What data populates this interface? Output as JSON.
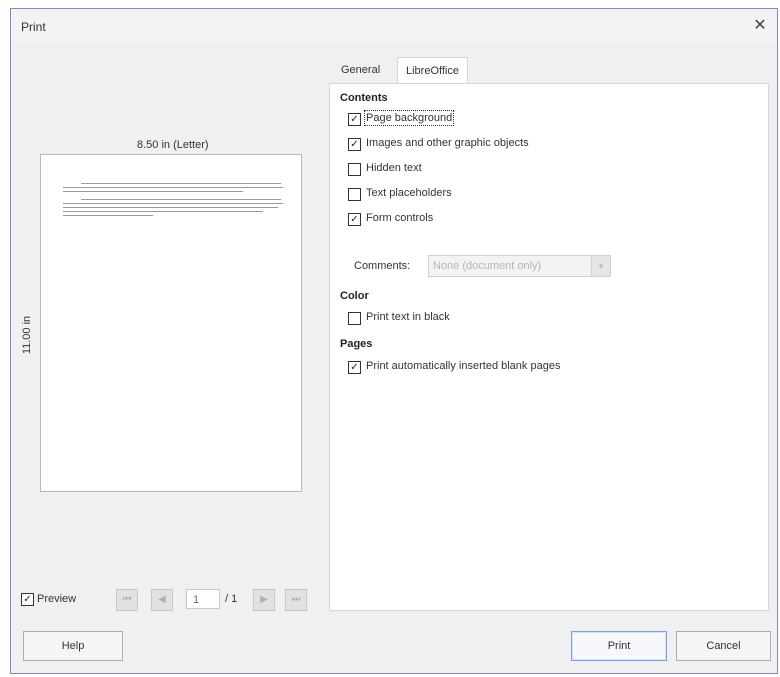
{
  "window": {
    "title": "Print",
    "close_glyph": "✕"
  },
  "preview": {
    "width_label": "8.50 in (Letter)",
    "height_label": "11.00 in",
    "preview_checkbox_label": "Preview",
    "preview_checked": true,
    "page_input_value": "1",
    "page_total": "/ 1"
  },
  "tabs": [
    "General",
    "LibreOffice Writer"
  ],
  "active_tab": "LibreOffice Writer",
  "writer": {
    "contents_heading": "Contents",
    "options": [
      {
        "label": "Page background",
        "checked": true
      },
      {
        "label": "Images and other graphic objects",
        "checked": true
      },
      {
        "label": "Hidden text",
        "checked": false
      },
      {
        "label": "Text placeholders",
        "checked": false
      },
      {
        "label": "Form controls",
        "checked": true
      }
    ],
    "comments_label": "Comments:",
    "comments_value": "None (document only)",
    "color_heading": "Color",
    "color_option": {
      "label": "Print text in black",
      "checked": false
    },
    "pages_heading": "Pages",
    "pages_option": {
      "label": "Print automatically inserted blank pages",
      "checked": true
    }
  },
  "buttons": {
    "help": "Help",
    "print": "Print",
    "cancel": "Cancel"
  },
  "icons": {
    "first": "⏮",
    "prev": "◀",
    "next": "▶",
    "last": "⏭",
    "dropdown": "▾",
    "check": "✓"
  }
}
